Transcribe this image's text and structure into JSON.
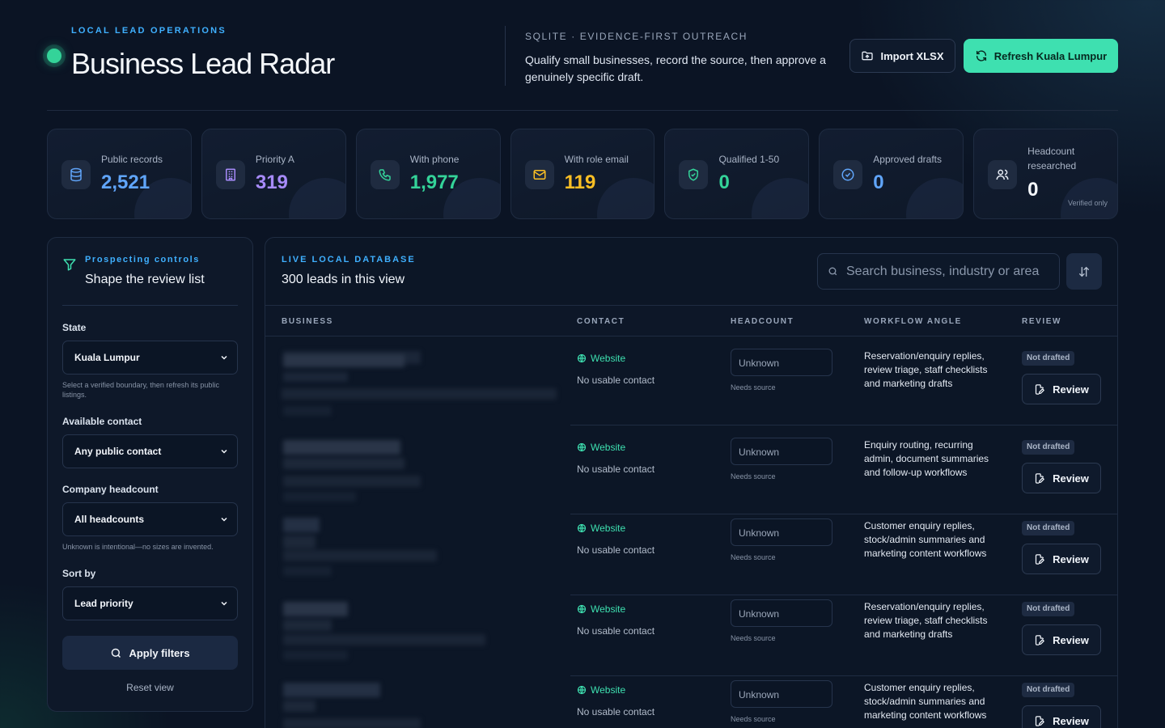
{
  "header": {
    "eyebrow": "LOCAL LEAD OPERATIONS",
    "title": "Business Lead Radar",
    "sub_eyebrow": "SQLITE · EVIDENCE-FIRST OUTREACH",
    "sub_text": "Qualify small businesses, record the source, then approve a genuinely specific draft.",
    "import_label": "Import XLSX",
    "refresh_label": "Refresh Kuala Lumpur"
  },
  "stats": [
    {
      "label": "Public records",
      "value": "2,521",
      "icon": "database-icon",
      "color": "#60a5fa"
    },
    {
      "label": "Priority A",
      "value": "319",
      "icon": "building-icon",
      "color": "#a78bfa"
    },
    {
      "label": "With phone",
      "value": "1,977",
      "icon": "phone-icon",
      "color": "#34d399"
    },
    {
      "label": "With role email",
      "value": "119",
      "icon": "mail-icon",
      "color": "#fbbf24"
    },
    {
      "label": "Qualified 1-50",
      "value": "0",
      "icon": "shield-check-icon",
      "color": "#34d399"
    },
    {
      "label": "Approved drafts",
      "value": "0",
      "icon": "check-circle-icon",
      "color": "#60a5fa"
    },
    {
      "label": "Headcount researched",
      "value": "0",
      "icon": "users-icon",
      "color": "#f4f7fb",
      "note": "Verified only"
    }
  ],
  "sidebar": {
    "eyebrow": "Prospecting controls",
    "title": "Shape the review list",
    "state_label": "State",
    "state_value": "Kuala Lumpur",
    "state_hint": "Select a verified boundary, then refresh its public listings.",
    "contact_label": "Available contact",
    "contact_value": "Any public contact",
    "headcount_label": "Company headcount",
    "headcount_value": "All headcounts",
    "headcount_hint": "Unknown is intentional—no sizes are invented.",
    "sort_label": "Sort by",
    "sort_value": "Lead priority",
    "apply_label": "Apply filters",
    "reset_label": "Reset view"
  },
  "panel": {
    "eyebrow": "LIVE LOCAL DATABASE",
    "title": "300 leads in this view",
    "search_placeholder": "Search business, industry or area",
    "columns": {
      "business": "BUSINESS",
      "contact": "CONTACT",
      "headcount": "HEADCOUNT",
      "angle": "WORKFLOW ANGLE",
      "review": "REVIEW"
    }
  },
  "rows": [
    {
      "contact_link": "Website",
      "contact_note": "No usable contact",
      "headcount": "Unknown",
      "headcount_source": "Needs source",
      "angle": "Reservation/enquiry replies, review triage, staff checklists and marketing drafts",
      "badge": "Not drafted",
      "review_label": "Review"
    },
    {
      "contact_link": "Website",
      "contact_note": "No usable contact",
      "headcount": "Unknown",
      "headcount_source": "Needs source",
      "angle": "Enquiry routing, recurring admin, document summaries and follow-up workflows",
      "badge": "Not drafted",
      "review_label": "Review"
    },
    {
      "contact_link": "Website",
      "contact_note": "No usable contact",
      "headcount": "Unknown",
      "headcount_source": "Needs source",
      "angle": "Customer enquiry replies, stock/admin summaries and marketing content workflows",
      "badge": "Not drafted",
      "review_label": "Review"
    },
    {
      "contact_link": "Website",
      "contact_note": "No usable contact",
      "headcount": "Unknown",
      "headcount_source": "Needs source",
      "angle": "Reservation/enquiry replies, review triage, staff checklists and marketing drafts",
      "badge": "Not drafted",
      "review_label": "Review"
    },
    {
      "contact_link": "Website",
      "contact_note": "No usable contact",
      "headcount": "Unknown",
      "headcount_source": "Needs source",
      "angle": "Customer enquiry replies, stock/admin summaries and marketing content workflows",
      "badge": "Not drafted",
      "review_label": "Review"
    }
  ]
}
